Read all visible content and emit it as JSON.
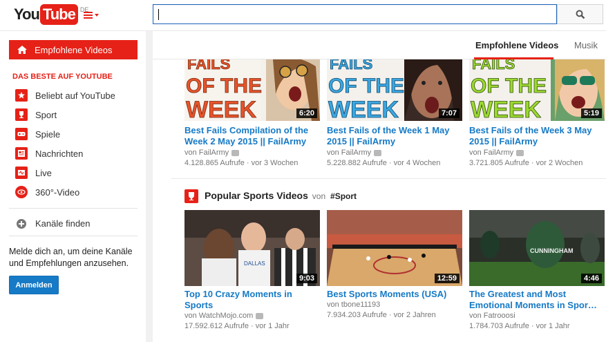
{
  "header": {
    "logo_you": "You",
    "logo_tube": "Tube",
    "logo_region": "DE",
    "search_placeholder": ""
  },
  "sidebar": {
    "active_item": "Empfohlene Videos",
    "section_title": "DAS BESTE AUF YOUTUBE",
    "items": [
      {
        "label": "Beliebt auf YouTube",
        "icon": "star-icon"
      },
      {
        "label": "Sport",
        "icon": "trophy-icon"
      },
      {
        "label": "Spiele",
        "icon": "gamepad-icon"
      },
      {
        "label": "Nachrichten",
        "icon": "news-icon"
      },
      {
        "label": "Live",
        "icon": "live-icon"
      },
      {
        "label": "360°-Video",
        "icon": "360-icon"
      }
    ],
    "find_channels": "Kanäle finden",
    "signin_text": "Melde dich an, um deine Kanäle und Empfehlungen anzusehen.",
    "signin_button": "Anmelden"
  },
  "tabs": [
    {
      "label": "Empfohlene Videos",
      "active": true
    },
    {
      "label": "Musik",
      "active": false
    }
  ],
  "row1": [
    {
      "title": "Best Fails Compilation of the Week 2 May 2015 || FailArmy",
      "channel": "von FailArmy",
      "views": "4.128.865 Aufrufe",
      "age": "vor 3 Wochen",
      "duration": "6:20",
      "color": "#e8542b"
    },
    {
      "title": "Best Fails of the Week 1 May 2015 || FailArmy",
      "channel": "von FailArmy",
      "views": "5.228.882 Aufrufe",
      "age": "vor 4 Wochen",
      "duration": "7:07",
      "color": "#3ba7e0"
    },
    {
      "title": "Best Fails of the Week 3 May 2015 || FailArmy",
      "channel": "von FailArmy",
      "views": "3.721.805 Aufrufe",
      "age": "vor 2 Wochen",
      "duration": "5:19",
      "color": "#9bd92f"
    }
  ],
  "shelf": {
    "title": "Popular Sports Videos",
    "von": "von",
    "tag": "#Sport"
  },
  "row2": [
    {
      "title": "Top 10 Crazy Moments in Sports",
      "channel": "von WatchMojo.com",
      "views": "17.592.612 Aufrufe",
      "age": "vor 1 Jahr",
      "duration": "9:03"
    },
    {
      "title": "Best Sports Moments (USA)",
      "channel": "von tbone11193",
      "views": "7.934.203 Aufrufe",
      "age": "vor 2 Jahren",
      "duration": "12:59"
    },
    {
      "title": "The Greatest and Most Emotional Moments in Spor…",
      "channel": "von Fatrooosi",
      "views": "1.784.703 Aufrufe",
      "age": "vor 1 Jahr",
      "duration": "4:46"
    }
  ],
  "thumb_text": {
    "fails": "FAILS",
    "of_the": "OF THE",
    "week": "WEEK"
  },
  "colors": {
    "brand": "#e62117",
    "link": "#167ac6"
  }
}
